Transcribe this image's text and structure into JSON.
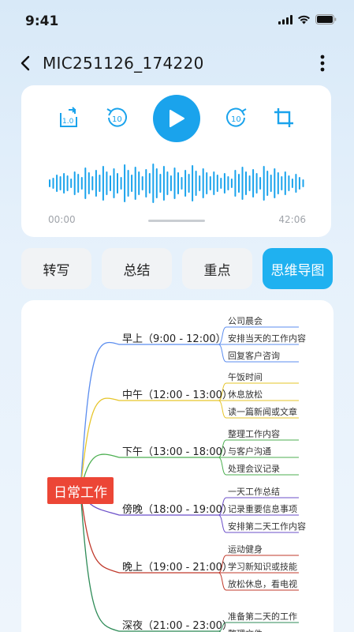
{
  "status": {
    "time": "9:41"
  },
  "header": {
    "title": "MIC251126_174220"
  },
  "player": {
    "speed_label": "1.0",
    "rewind_label": "10",
    "forward_label": "10",
    "time_start": "00:00",
    "time_end": "42:06",
    "colors": {
      "accent": "#1aa3ec"
    }
  },
  "tabs": [
    {
      "label": "转写",
      "active": false
    },
    {
      "label": "总结",
      "active": false
    },
    {
      "label": "重点",
      "active": false
    },
    {
      "label": "思维导图",
      "active": true
    }
  ],
  "mindmap": {
    "root": "日常工作",
    "branches": [
      {
        "label": "早上（9:00 - 12:00）",
        "color": "#5b8def",
        "leaves": [
          "公司晨会",
          "安排当天的工作内容",
          "回复客户咨询"
        ]
      },
      {
        "label": "中午（12:00 - 13:00）",
        "color": "#e6c52a",
        "leaves": [
          "午饭时间",
          "休息放松",
          "读一篇新闻或文章"
        ]
      },
      {
        "label": "下午（13:00 - 18:00）",
        "color": "#4caf50",
        "leaves": [
          "整理工作内容",
          "与客户沟通",
          "处理会议记录"
        ]
      },
      {
        "label": "傍晚（18:00 - 19:00）",
        "color": "#6b4fc9",
        "leaves": [
          "一天工作总结",
          "记录重要信息事项",
          "安排第二天工作内容"
        ]
      },
      {
        "label": "晚上（19:00 - 21:00）",
        "color": "#c0392b",
        "leaves": [
          "运动健身",
          "学习新知识或技能",
          "放松休息，看电视"
        ]
      },
      {
        "label": "深夜（21:00 - 23:00）",
        "color": "#2e8b57",
        "leaves": [
          "准备第二天的工作",
          "整理文件"
        ]
      }
    ]
  }
}
